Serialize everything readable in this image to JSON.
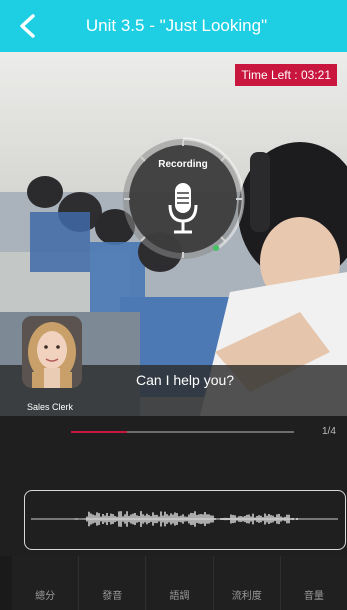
{
  "header": {
    "title": "Unit 3.5 - \"Just Looking\"",
    "back_icon": "chevron-left-icon"
  },
  "timer": {
    "text": "Time Left : 03:21"
  },
  "recorder": {
    "label": "Recording",
    "icon": "microphone-icon"
  },
  "dialog": {
    "speaker": "Sales Clerk",
    "line": "Can I help you?"
  },
  "progress": {
    "value": 0.25,
    "label": "1/4"
  },
  "tabs": [
    {
      "label": "總分"
    },
    {
      "label": "發音"
    },
    {
      "label": "語調"
    },
    {
      "label": "流利度"
    },
    {
      "label": "音量"
    }
  ],
  "colors": {
    "header": "#1ecfe3",
    "accent": "#c8163f",
    "panel": "#1f1f1f"
  }
}
